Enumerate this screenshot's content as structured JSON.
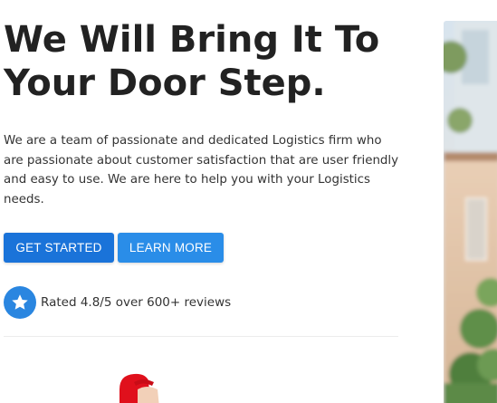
{
  "hero": {
    "title_line1": "We Will Bring It To",
    "title_line2": "Your Door Step.",
    "description": "We are a team of passionate and dedicated Logistics firm who are passionate about customer satisfaction that are user friendly and easy to use. We are here to help you with your Logistics needs."
  },
  "actions": {
    "get_started_label": "GET STARTED",
    "learn_more_label": "LEARN MORE"
  },
  "rating": {
    "icon": "star-icon",
    "text": "Rated 4.8/5 over 600+ reviews"
  },
  "colors": {
    "primary_button": "#1a73d9",
    "secondary_button": "#2a8de8",
    "star_badge": "#2a86e0",
    "heading": "#222222"
  },
  "images": {
    "hero_photo": "house-photo",
    "mascot": "delivery-mascot"
  }
}
